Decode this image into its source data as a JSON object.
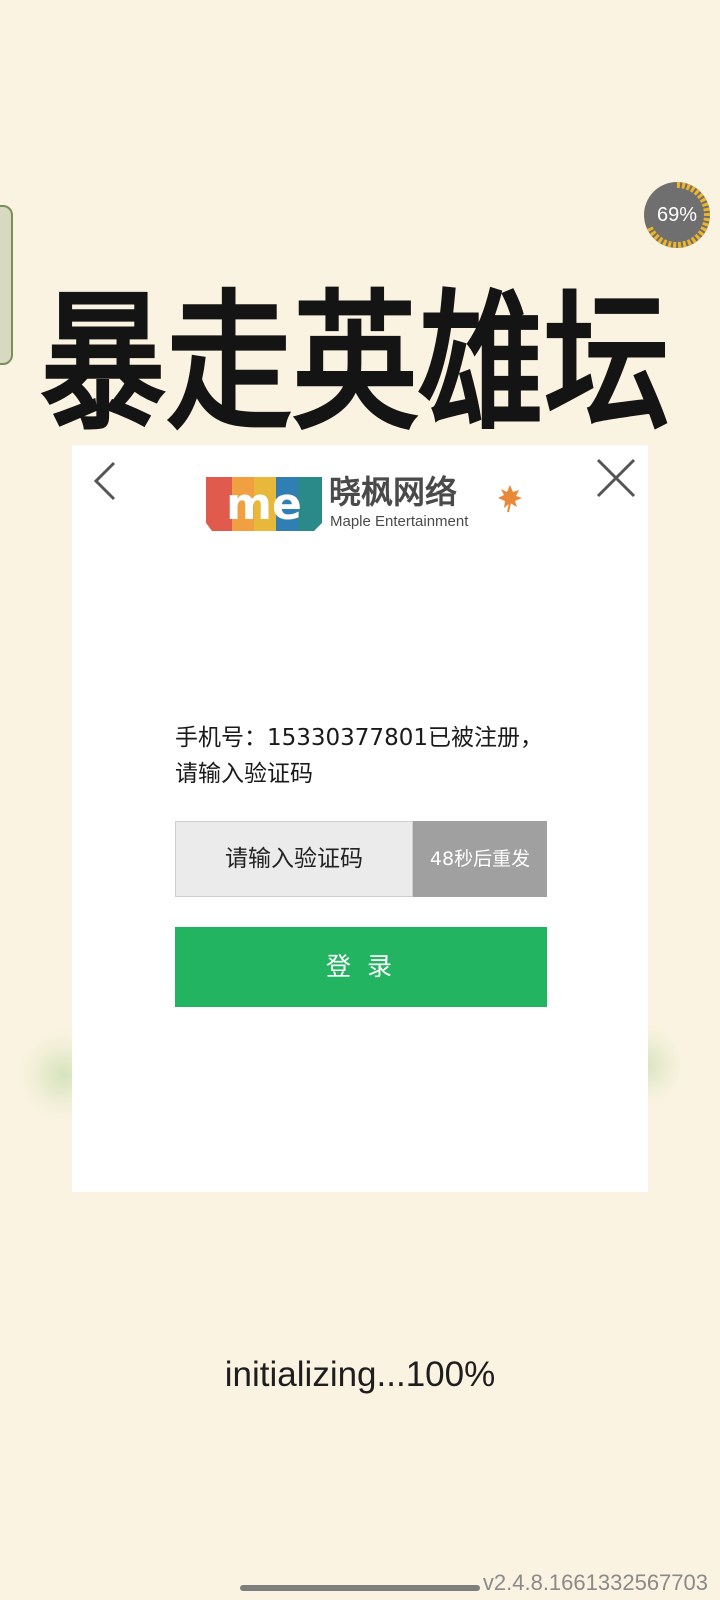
{
  "game": {
    "title_art": "暴走英雄坛"
  },
  "progress_badge": {
    "text": "69%",
    "value": 0.69,
    "ring_color": "#f0b428",
    "track_color": "#6f6f6f"
  },
  "dialog": {
    "logo": {
      "mark_text": "me",
      "name_cn": "晓枫网络",
      "name_en": "Maple Entertainment"
    },
    "message": "手机号：15330377801已被注册，请输入验证码",
    "code_input": {
      "placeholder": "请输入验证码",
      "value": ""
    },
    "resend_label": "48秒后重发",
    "login_label": "登 录",
    "colors": {
      "login_button": "#22b460",
      "resend_button": "#a0a0a0"
    }
  },
  "status": {
    "text": "initializing...100%"
  },
  "version": "v2.4.8.1661332567703"
}
